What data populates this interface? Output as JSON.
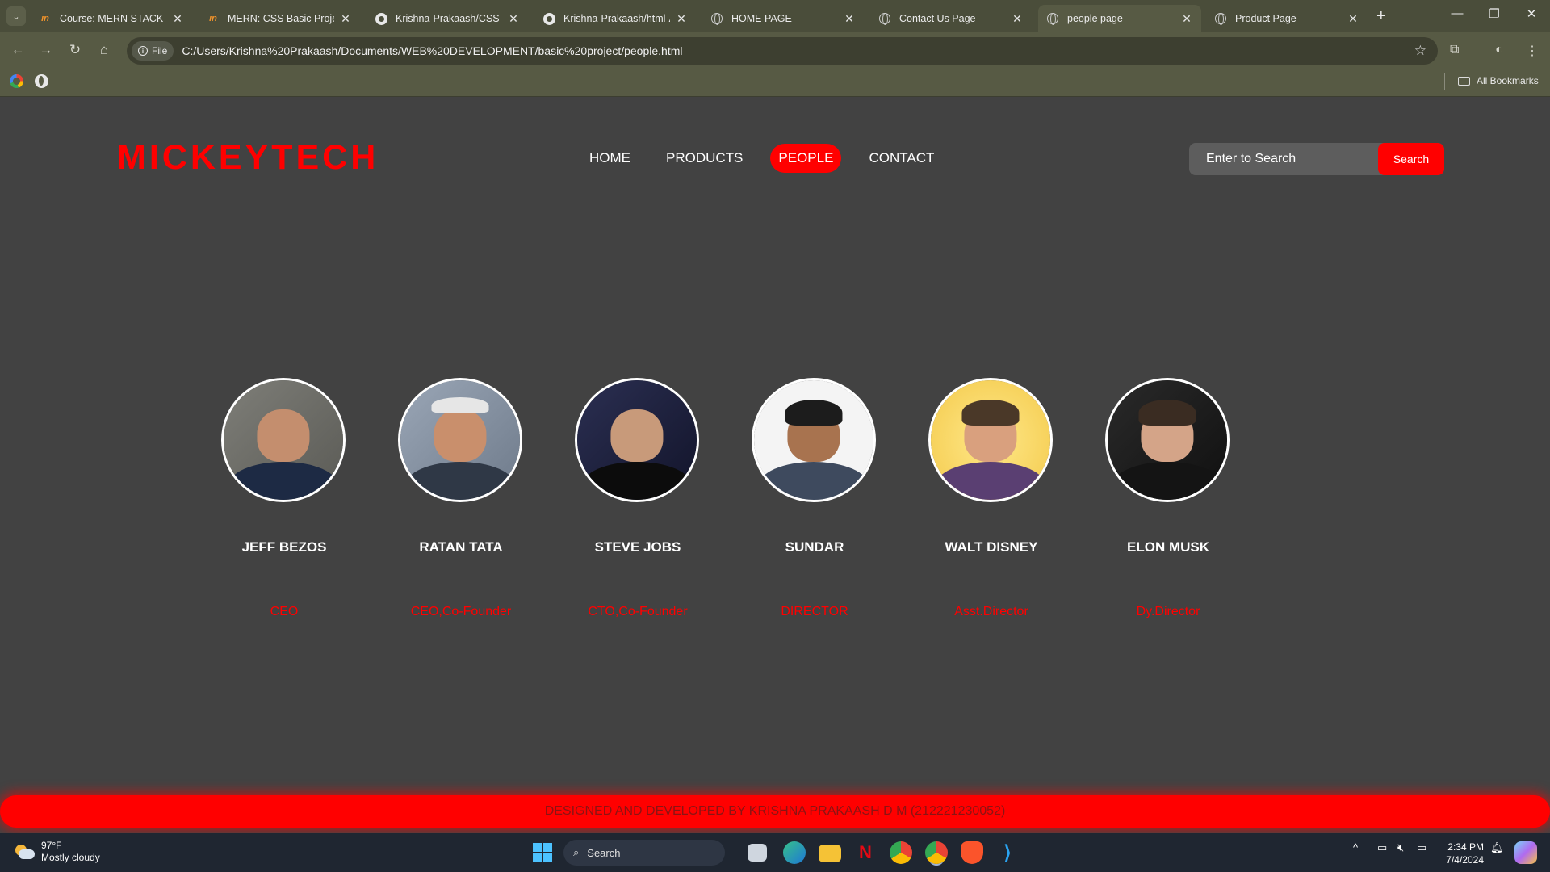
{
  "browser": {
    "tabs": [
      {
        "title": "Course: MERN STACK | SE",
        "icon": "udemy-icon"
      },
      {
        "title": "MERN: CSS Basic Project -",
        "icon": "udemy-icon"
      },
      {
        "title": "Krishna-Prakaash/CSS-BA",
        "icon": "github-icon"
      },
      {
        "title": "Krishna-Prakaash/html-AI",
        "icon": "github-icon"
      },
      {
        "title": "HOME PAGE",
        "icon": "globe-icon"
      },
      {
        "title": "Contact Us Page",
        "icon": "globe-icon"
      },
      {
        "title": "people page",
        "icon": "globe-icon",
        "active": true
      },
      {
        "title": "Product Page",
        "icon": "globe-icon"
      }
    ],
    "address_chip": "File",
    "url": "C:/Users/Krishna%20Prakaash/Documents/WEB%20DEVELOPMENT/basic%20project/people.html",
    "all_bookmarks": "All Bookmarks"
  },
  "site": {
    "logo": "MICKEYTECH",
    "nav": [
      "HOME",
      "PRODUCTS",
      "PEOPLE",
      "CONTACT"
    ],
    "active_nav": "PEOPLE",
    "search_placeholder": "Enter to Search",
    "search_button": "Search",
    "people": [
      {
        "name": "JEFF BEZOS",
        "role": "CEO"
      },
      {
        "name": "RATAN TATA",
        "role": "CEO,Co-Founder"
      },
      {
        "name": "STEVE JOBS",
        "role": "CTO,Co-Founder"
      },
      {
        "name": "SUNDAR",
        "role": "DIRECTOR"
      },
      {
        "name": "WALT DISNEY",
        "role": "Asst.Director"
      },
      {
        "name": "ELON MUSK",
        "role": "Dy.Director"
      }
    ],
    "footer": "DESIGNED AND DEVELOPED BY KRISHNA PRAKAASH D M (212221230052)"
  },
  "taskbar": {
    "temperature": "97°F",
    "weather": "Mostly cloudy",
    "search": "Search",
    "time": "2:34 PM",
    "date": "7/4/2024"
  },
  "colors": {
    "accent": "#ff0000",
    "page_background": "#424242",
    "browser_frame": "#575a44"
  }
}
